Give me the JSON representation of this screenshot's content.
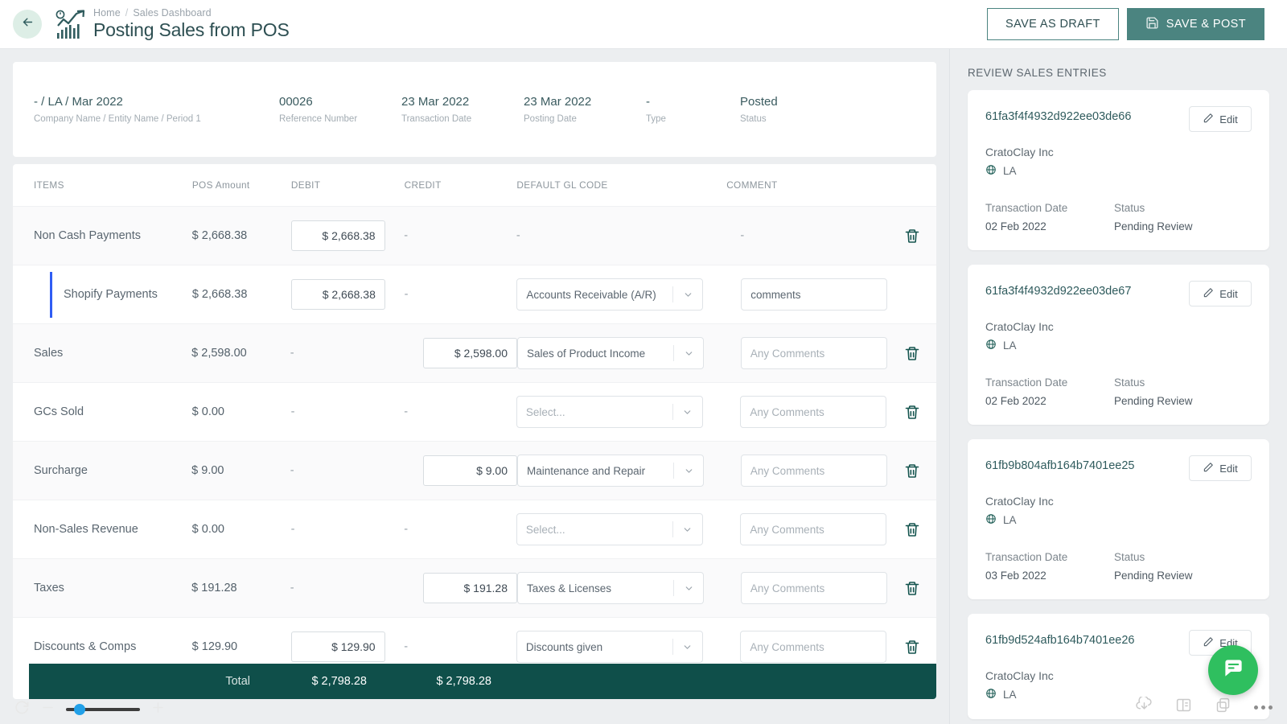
{
  "header": {
    "back_icon": "arrow-left-icon",
    "logo_icon": "growth-chart-icon",
    "breadcrumb": {
      "home": "Home",
      "separator": "/",
      "current": "Sales Dashboard"
    },
    "title": "Posting Sales from POS",
    "save_draft_label": "SAVE AS DRAFT",
    "save_post_label": "SAVE & POST",
    "save_post_icon": "floppy-disk-icon",
    "accent_color": "#4b8480"
  },
  "meta": [
    {
      "value": "- / LA / Mar 2022",
      "label": "Company Name / Entity Name / Period 1"
    },
    {
      "value": "00026",
      "label": "Reference Number"
    },
    {
      "value": "23 Mar 2022",
      "label": "Transaction Date"
    },
    {
      "value": "23 Mar 2022",
      "label": "Posting Date"
    },
    {
      "value": "-",
      "label": "Type"
    },
    {
      "value": "Posted",
      "label": "Status"
    }
  ],
  "table": {
    "columns": [
      "ITEMS",
      "POS Amount",
      "DEBIT",
      "CREDIT",
      "DEFAULT GL CODE",
      "COMMENT"
    ],
    "rows": [
      {
        "name": "Non Cash Payments",
        "pos": "$ 2,668.38",
        "debit": "$ 2,668.38",
        "debit_input": true,
        "credit": "-",
        "credit_input": false,
        "gl": "-",
        "gl_input": false,
        "comment": "-",
        "comment_input": false,
        "indent": false,
        "accent": false,
        "shaded": true,
        "delete_icon": "trash-icon"
      },
      {
        "name": "Shopify Payments",
        "pos": "$ 2,668.38",
        "debit": "$ 2,668.38",
        "debit_input": true,
        "credit": "-",
        "credit_input": false,
        "gl": "Accounts Receivable (A/R)",
        "gl_input": true,
        "gl_placeholder": false,
        "comment": "comments",
        "comment_input": true,
        "comment_placeholder": false,
        "indent": true,
        "accent": true,
        "accent_color": "#2f5df4",
        "shaded": false,
        "delete_icon": null
      },
      {
        "name": "Sales",
        "pos": "$ 2,598.00",
        "debit": "-",
        "debit_input": false,
        "credit": "$ 2,598.00",
        "credit_input": true,
        "gl": "Sales of Product Income",
        "gl_input": true,
        "gl_placeholder": false,
        "comment": "Any Comments",
        "comment_input": true,
        "comment_placeholder": true,
        "indent": false,
        "accent": false,
        "shaded": true,
        "delete_icon": "trash-icon"
      },
      {
        "name": "GCs Sold",
        "pos": "$ 0.00",
        "debit": "-",
        "debit_input": false,
        "credit": "-",
        "credit_input": false,
        "gl": "Select...",
        "gl_input": true,
        "gl_placeholder": true,
        "comment": "Any Comments",
        "comment_input": true,
        "comment_placeholder": true,
        "indent": false,
        "accent": false,
        "shaded": false,
        "delete_icon": "trash-icon"
      },
      {
        "name": "Surcharge",
        "pos": "$ 9.00",
        "debit": "-",
        "debit_input": false,
        "credit": "$ 9.00",
        "credit_input": true,
        "gl": "Maintenance and Repair",
        "gl_input": true,
        "gl_placeholder": false,
        "comment": "Any Comments",
        "comment_input": true,
        "comment_placeholder": true,
        "indent": false,
        "accent": false,
        "shaded": true,
        "delete_icon": "trash-icon"
      },
      {
        "name": "Non-Sales Revenue",
        "pos": "$ 0.00",
        "debit": "-",
        "debit_input": false,
        "credit": "-",
        "credit_input": false,
        "gl": "Select...",
        "gl_input": true,
        "gl_placeholder": true,
        "comment": "Any Comments",
        "comment_input": true,
        "comment_placeholder": true,
        "indent": false,
        "accent": false,
        "shaded": false,
        "delete_icon": "trash-icon"
      },
      {
        "name": "Taxes",
        "pos": "$ 191.28",
        "debit": "-",
        "debit_input": false,
        "credit": "$ 191.28",
        "credit_input": true,
        "gl": "Taxes & Licenses",
        "gl_input": true,
        "gl_placeholder": false,
        "comment": "Any Comments",
        "comment_input": true,
        "comment_placeholder": true,
        "indent": false,
        "accent": false,
        "shaded": true,
        "delete_icon": "trash-icon"
      },
      {
        "name": "Discounts & Comps",
        "pos": "$ 129.90",
        "debit": "$ 129.90",
        "debit_input": true,
        "credit": "-",
        "credit_input": false,
        "gl": "Discounts given",
        "gl_input": true,
        "gl_placeholder": false,
        "comment": "Any Comments",
        "comment_input": true,
        "comment_placeholder": true,
        "indent": false,
        "accent": false,
        "shaded": false,
        "delete_icon": "trash-icon"
      }
    ],
    "total": {
      "label": "Total",
      "debit": "$ 2,798.28",
      "credit": "$ 2,798.28",
      "bar_color": "#0f4f4a"
    }
  },
  "review_panel": {
    "title": "REVIEW SALES ENTRIES",
    "edit_label": "Edit",
    "edit_icon": "pencil-icon",
    "location_icon": "globe-icon",
    "labels": {
      "transaction_date": "Transaction Date",
      "status": "Status"
    },
    "cards": [
      {
        "id": "61fa3f4f4932d922ee03de66",
        "org": "CratoClay Inc",
        "location": "LA",
        "transaction_date": "02 Feb 2022",
        "status": "Pending Review"
      },
      {
        "id": "61fa3f4f4932d922ee03de67",
        "org": "CratoClay Inc",
        "location": "LA",
        "transaction_date": "02 Feb 2022",
        "status": "Pending Review"
      },
      {
        "id": "61fb9b804afb164b7401ee25",
        "org": "CratoClay Inc",
        "location": "LA",
        "transaction_date": "03 Feb 2022",
        "status": "Pending Review"
      },
      {
        "id": "61fb9d524afb164b7401ee26",
        "org": "CratoClay Inc",
        "location": "LA",
        "transaction_date": "",
        "status": ""
      }
    ]
  },
  "bottom_chrome": {
    "refresh_icon": "refresh-icon",
    "zoom_out_icon": "minus-icon",
    "zoom_in_icon": "plus-icon",
    "download_icon": "download-cloud-icon",
    "layout_icon": "panel-layout-icon",
    "copy_icon": "copy-icon",
    "more_icon": "more-dots-icon",
    "chat_icon": "chat-message-icon",
    "chat_color": "#2fbf5f"
  }
}
